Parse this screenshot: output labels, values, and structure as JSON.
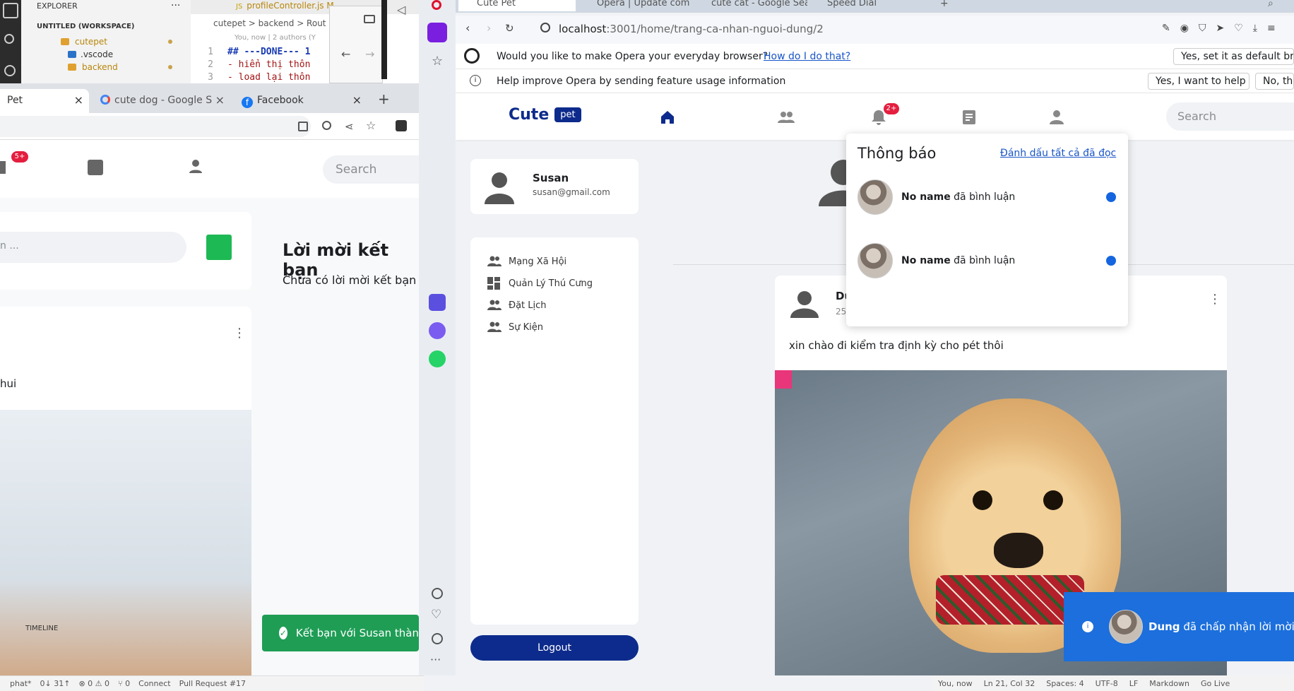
{
  "vscode": {
    "explorer_title": "EXPLORER",
    "workspace": "UNTITLED (WORKSPACE)",
    "tree": [
      "cutepet",
      ".vscode",
      "backend"
    ],
    "tab_file": "profileController.js",
    "tab_marker": "M",
    "breadcrumb": "cutepet > backend > Rout",
    "blame": "You, now | 2 authors (Y",
    "lines": [
      {
        "num": "1",
        "text": "## ---DONE--- 1"
      },
      {
        "num": "2",
        "text": "- hiển thị thôn"
      },
      {
        "num": "3",
        "text": "- load lại thôn"
      }
    ],
    "timeline": "TIMELINE",
    "status_left": [
      "phat*",
      "0↓ 31↑",
      "⊗ 0 ⚠ 0",
      "⑂ 0",
      "Connect",
      "Pull Request #17"
    ],
    "status_right": [
      "You, now",
      "Ln 21, Col 32",
      "Spaces: 4",
      "UTF-8",
      "LF",
      "Markdown",
      "Go Live"
    ]
  },
  "chrome_left": {
    "tabs": [
      "Pet",
      "cute dog - Google S",
      "Facebook"
    ],
    "badge": "5+",
    "search_placeholder": "Search",
    "heading": "Lời mời kết bạn",
    "no_invites": "Chưa có lời mời kết bạn",
    "input_placeholder": "n ...",
    "post_text": "hui",
    "toast": "Kết bạn với Susan thàn"
  },
  "opera": {
    "tabs": [
      "Cute Pet",
      "Opera | Update com",
      "cute cat - Google Sea",
      "Speed Dial"
    ],
    "url_host": "localhost",
    "url_path": ":3001/home/trang-ca-nhan-nguoi-dung/2",
    "prompt1": "Would you like to make Opera your everyday browser?",
    "prompt1_link": "How do I do that?",
    "prompt1_btn": "Yes, set it as default bro",
    "prompt2": "Help improve Opera by sending feature usage information",
    "prompt2_btn": "Yes, I want to help",
    "prompt2_btn2": "No, th"
  },
  "app": {
    "logo_text": "Cute",
    "logo_badge": "pet",
    "notif_badge": "2+",
    "search_placeholder": "Search",
    "user_name": "Susan",
    "user_email": "susan@gmail.com",
    "menu": [
      "Mạng Xã Hội",
      "Quản Lý Thú Cưng",
      "Đặt Lịch",
      "Sự Kiện"
    ],
    "logout": "Logout",
    "notifications": {
      "title": "Thông báo",
      "mark_all": "Đánh dấu tất cả đã đọc",
      "items": [
        {
          "name": "No name",
          "action": "đã bình luận"
        },
        {
          "name": "No name",
          "action": "đã bình luận"
        }
      ]
    },
    "post": {
      "author": "Du",
      "date": "25",
      "text": "xin chào đi kiểm tra định kỳ cho pét thôi"
    },
    "toast": {
      "name": "Dung",
      "text": "đã chấp nhận lời mời k"
    }
  }
}
